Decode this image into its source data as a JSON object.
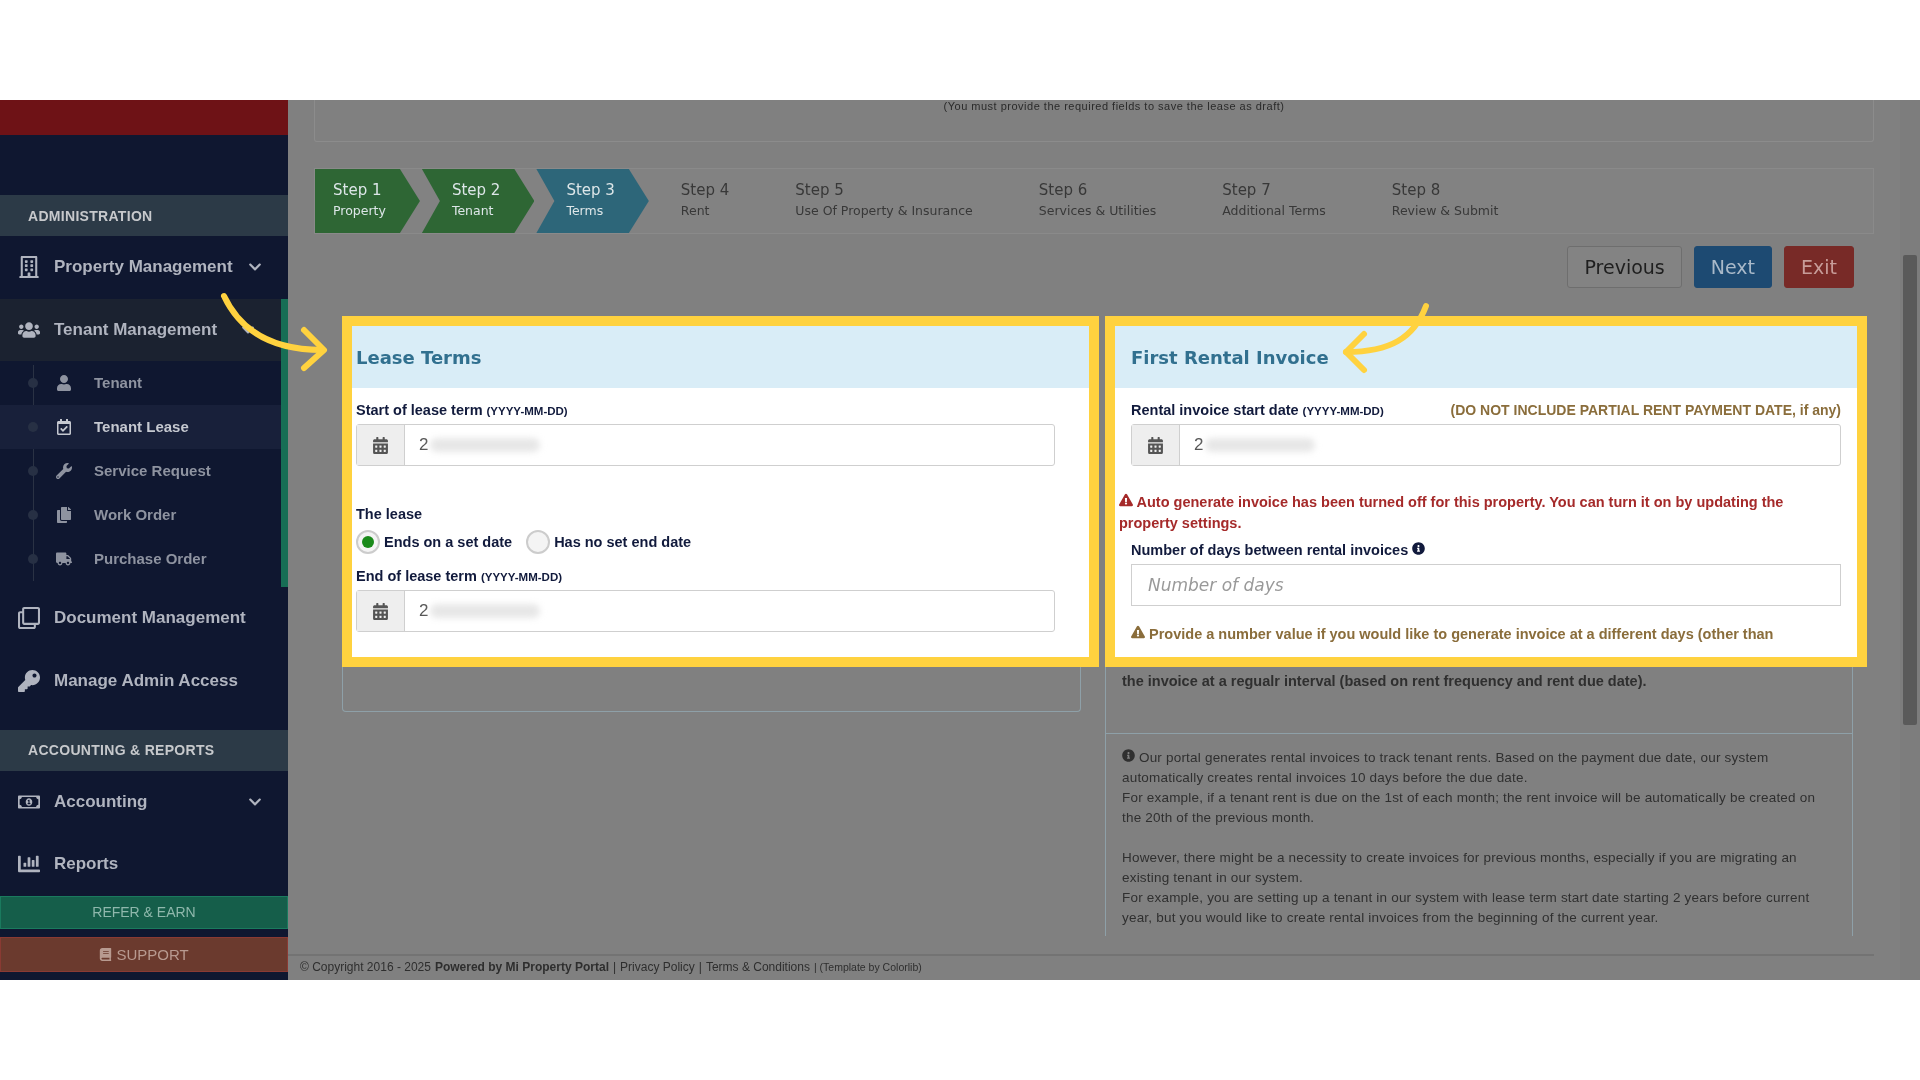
{
  "top_note": "(You must provide the required fields to save the lease as draft)",
  "sidebar": {
    "sections": [
      {
        "title": "ADMINISTRATION",
        "items": [
          {
            "label": "Property Management",
            "expanded": false
          },
          {
            "label": "Tenant Management",
            "expanded": true,
            "children": [
              {
                "label": "Tenant",
                "selected": false
              },
              {
                "label": "Tenant Lease",
                "selected": true
              },
              {
                "label": "Service Request",
                "selected": false
              },
              {
                "label": "Work Order",
                "selected": false
              },
              {
                "label": "Purchase Order",
                "selected": false
              }
            ]
          },
          {
            "label": "Document Management"
          },
          {
            "label": "Manage Admin Access"
          }
        ]
      },
      {
        "title": "ACCOUNTING & REPORTS",
        "items": [
          {
            "label": "Accounting",
            "expanded": false
          },
          {
            "label": "Reports"
          }
        ]
      }
    ],
    "refer_button": "REFER & EARN",
    "support_button": "SUPPORT"
  },
  "steps": [
    {
      "step": "Step 1",
      "label": "Property",
      "completed": true,
      "selected": false
    },
    {
      "step": "Step 2",
      "label": "Tenant",
      "completed": true,
      "selected": false
    },
    {
      "step": "Step 3",
      "label": "Terms",
      "completed": false,
      "selected": true
    },
    {
      "step": "Step 4",
      "label": "Rent",
      "completed": false,
      "selected": false
    },
    {
      "step": "Step 5",
      "label": "Use Of Property & Insurance",
      "completed": false,
      "selected": false
    },
    {
      "step": "Step 6",
      "label": "Services & Utilities",
      "completed": false,
      "selected": false
    },
    {
      "step": "Step 7",
      "label": "Additional Terms",
      "completed": false,
      "selected": false
    },
    {
      "step": "Step 8",
      "label": "Review & Submit",
      "completed": false,
      "selected": false
    }
  ],
  "buttons": [
    {
      "label": "Previous",
      "kind": "default"
    },
    {
      "label": "Next",
      "kind": "primary"
    },
    {
      "label": "Exit",
      "kind": "danger"
    }
  ],
  "lease_terms": {
    "title": "Lease Terms",
    "start_label": "Start of lease term",
    "start_hint": "(YYYY-MM-DD)",
    "start_value": "2",
    "lease_label": "The lease",
    "options": [
      {
        "label": "Ends on a set date",
        "selected": true
      },
      {
        "label": "Has no set end date",
        "selected": false
      }
    ],
    "end_label": "End of lease term",
    "end_hint": "(YYYY-MM-DD)",
    "end_value": "2"
  },
  "first_invoice": {
    "title": "First Rental Invoice",
    "start_label": "Rental invoice start date",
    "start_hint": "(YYYY-MM-DD)",
    "start_note": "(DO NOT INCLUDE PARTIAL RENT PAYMENT DATE, if any)",
    "start_value": "2",
    "alert": "Auto generate invoice has been turned off for this property. You can turn it on by updating the property settings.",
    "days_label": "Number of days between rental invoices",
    "days_placeholder": "Number of days",
    "warning": "Provide a number value if you would like to generate invoice at a different days (other than",
    "warning_end": "the invoice at a regualr interval (based on rent frequency and rent due date).",
    "info": [
      "Our portal generates rental invoices to track tenant rents. Based on the payment due date, our system automatically creates rental invoices 10 days before the due date.",
      "For example, if a tenant rent is due on the 1st of each month; the rent invoice will be automatically be created on the 20th of the previous month.",
      "However, there might be a necessity to create invoices for previous months, especially if you are migrating an existing tenant in our system.",
      "For example, you are setting up a tenant in our system with lease term start date starting 2 years before current year, but you would like to create rental invoices from the beginning of the current year."
    ]
  },
  "footer": [
    {
      "text": "© Copyright 2016 - 2025",
      "kind": "plain"
    },
    {
      "text": "Powered by Mi Property Portal",
      "kind": "bold"
    },
    {
      "text": "|",
      "kind": "plain"
    },
    {
      "text": "Privacy Policy",
      "kind": "link"
    },
    {
      "text": "|",
      "kind": "plain"
    },
    {
      "text": "Terms & Conditions",
      "kind": "link"
    },
    {
      "text": "| (Template by Colorlib)",
      "kind": "small"
    }
  ]
}
